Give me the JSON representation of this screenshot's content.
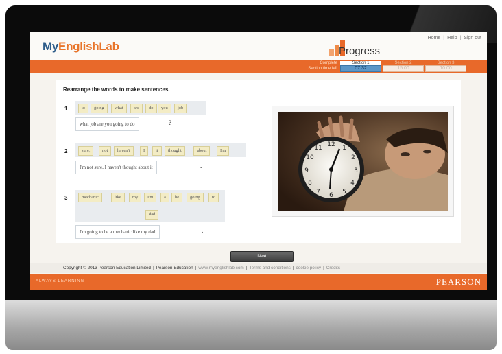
{
  "header": {
    "logo_my": "My",
    "logo_rest": "EnglishLab",
    "progress_title": "Progress",
    "links": [
      "Home",
      "Help",
      "Sign out"
    ]
  },
  "status": {
    "complete_label": "Complete",
    "time_left_label": "Section time left",
    "sections": [
      {
        "name": "Section 1",
        "time": "07:32",
        "active": true
      },
      {
        "name": "Section 2",
        "time": "15:00",
        "active": false
      },
      {
        "name": "Section 3",
        "time": "10:00",
        "active": false
      }
    ]
  },
  "exercise": {
    "instruction": "Rearrange the words to make sentences.",
    "questions": [
      {
        "number": "1",
        "words": [
          "to",
          "going",
          "what",
          "are",
          "do",
          "you",
          "job"
        ],
        "answer": "what job are you going to do",
        "punctuation": "?"
      },
      {
        "number": "2",
        "words": [
          "sure,",
          "not",
          "haven't",
          "I",
          "it",
          "thought",
          "about",
          "I'm"
        ],
        "answer": "I'm not sure, I haven't thought about it",
        "punctuation": "."
      },
      {
        "number": "3",
        "words": [
          "mechanic",
          "like",
          "my",
          "I'm",
          "a",
          "be",
          "going",
          "to",
          "dad"
        ],
        "answer": "I'm going to be a mechanic like my dad",
        "punctuation": "."
      }
    ]
  },
  "next_label": "Next",
  "footer": {
    "copyright": "Copyright © 2013 Pearson Education Limited",
    "pearson_education": "Pearson Education",
    "site": "www.myenglishlab.com",
    "terms": "Terms and conditions",
    "cookie": "cookie policy",
    "credits": "Credits",
    "always_learning": "ALWAYS LEARNING",
    "brand": "PEARSON"
  },
  "colors": {
    "accent_orange": "#e8692a",
    "logo_blue": "#2e5d8a",
    "timer_blue": "#5b96c7"
  }
}
